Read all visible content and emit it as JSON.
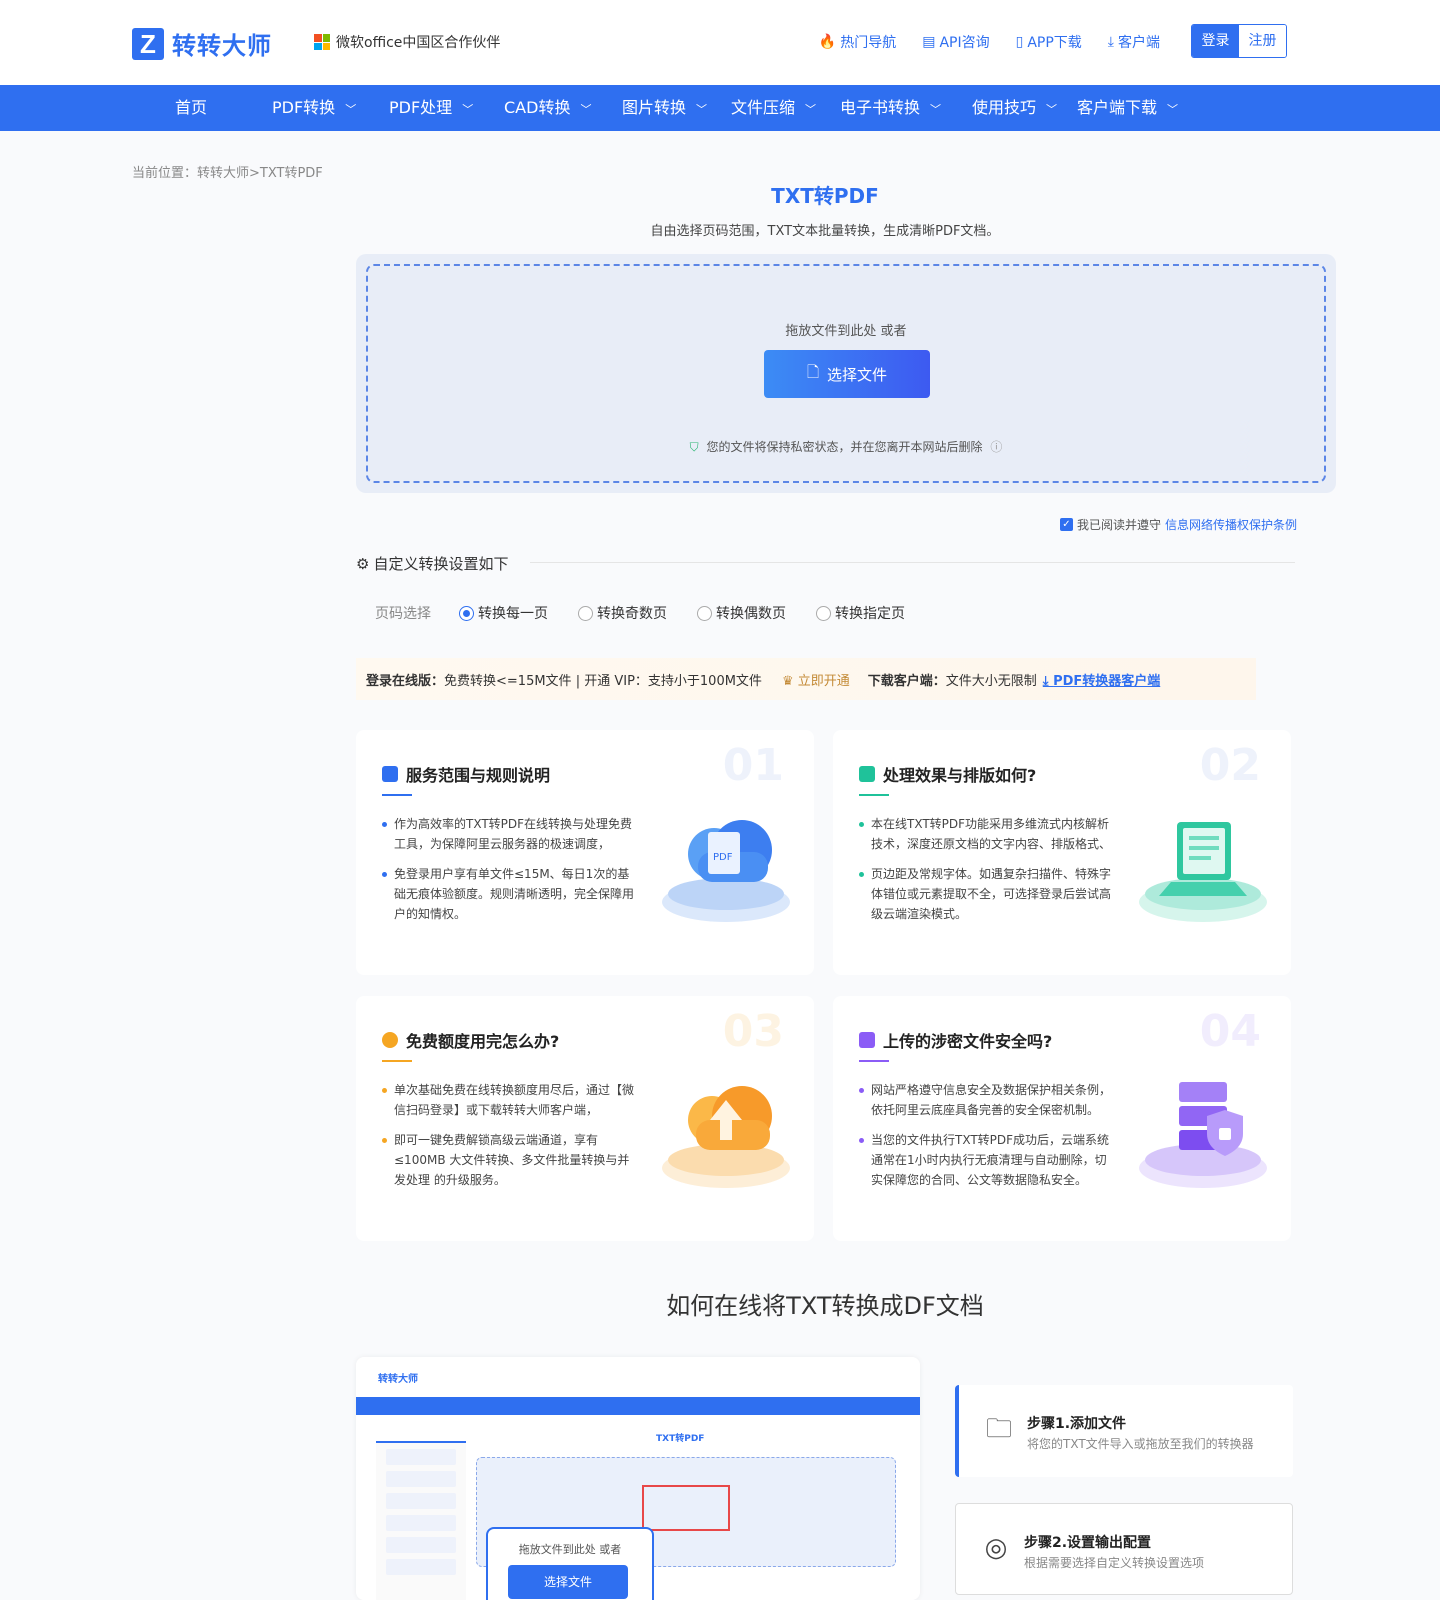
{
  "header": {
    "logo_text": "转转大师",
    "partner": "微软office中国区合作伙伴",
    "links": [
      {
        "label": "热门导航",
        "icon": "flame-icon"
      },
      {
        "label": "API咨询",
        "icon": "chat-icon"
      },
      {
        "label": "APP下载",
        "icon": "phone-icon"
      },
      {
        "label": "客户端",
        "icon": "download-icon"
      }
    ],
    "login": "登录",
    "register": "注册"
  },
  "nav": {
    "items": [
      "首页",
      "PDF转换",
      "PDF处理",
      "CAD转换",
      "图片转换",
      "文件压缩",
      "电子书转换",
      "使用技巧",
      "客户端下载"
    ]
  },
  "breadcrumb": "当前位置：转转大师>TXT转PDF",
  "page": {
    "title": "TXT转PDF",
    "subtitle": "自由选择页码范围，TXT文本批量转换，生成清晰PDF文档。"
  },
  "upload": {
    "drop_text": "拖放文件到此处 或者",
    "button": "选择文件",
    "privacy": "您的文件将保持私密状态，并在您离开本网站后删除"
  },
  "agree": {
    "text": "我已阅读并遵守",
    "link": "信息网络传播权保护条例"
  },
  "settings": {
    "title": "自定义转换设置如下",
    "page_label": "页码选择",
    "options": [
      "转换每一页",
      "转换奇数页",
      "转换偶数页",
      "转换指定页"
    ],
    "selected": 0
  },
  "promo": {
    "online_label": "登录在线版：",
    "online_text": "免费转换<=15M文件 | 开通 VIP：支持小于100M文件",
    "vip_button": "立即开通",
    "client_label": "下载客户端：",
    "client_text": "文件大小无限制",
    "client_link": "PDF转换器客户端"
  },
  "cards": [
    {
      "num": "01",
      "title": "服务范围与规则说明",
      "color": "#2f6ff0",
      "points": [
        "作为高效率的TXT转PDF在线转换与处理免费工具，为保障阿里云服务器的极速调度，",
        "免登录用户享有单文件≤15M、每日1次的基础无痕体验额度。规则清晰透明，完全保障用户的知情权。"
      ]
    },
    {
      "num": "02",
      "title": "处理效果与排版如何?",
      "color": "#1fc29a",
      "points": [
        "本在线TXT转PDF功能采用多维流式内核解析技术，深度还原文档的文字内容、排版格式、",
        "页边距及常规字体。如遇复杂扫描件、特殊字体错位或元素提取不全，可选择登录后尝试高级云端渲染模式。"
      ]
    },
    {
      "num": "03",
      "title": "免费额度用完怎么办?",
      "color": "#f5a623",
      "points": [
        "单次基础免费在线转换额度用尽后，通过【微信扫码登录】或下载转转大师客户端，",
        "即可一键免费解锁高级云端通道，享有≤100MB 大文件转换、多文件批量转换与并发处理 的升级服务。"
      ]
    },
    {
      "num": "04",
      "title": "上传的涉密文件安全吗?",
      "color": "#8b5cf6",
      "points": [
        "网站严格遵守信息安全及数据保护相关条例，依托阿里云底座具备完善的安全保密机制。",
        "当您的文件执行TXT转PDF成功后，云端系统通常在1小时内执行无痕清理与自动删除，切实保障您的合同、公文等数据隐私安全。"
      ]
    }
  ],
  "how_title": "如何在线将TXT转换成DF文档",
  "mock": {
    "logo": "转转大师",
    "title": "TXT转PDF",
    "drop_text": "拖放文件到此处 或者",
    "button": "选择文件"
  },
  "steps": [
    {
      "title": "步骤1.添加文件",
      "desc": "将您的TXT文件导入或拖放至我们的转换器"
    },
    {
      "title": "步骤2.设置输出配置",
      "desc": "根据需要选择自定义转换设置选项"
    }
  ]
}
